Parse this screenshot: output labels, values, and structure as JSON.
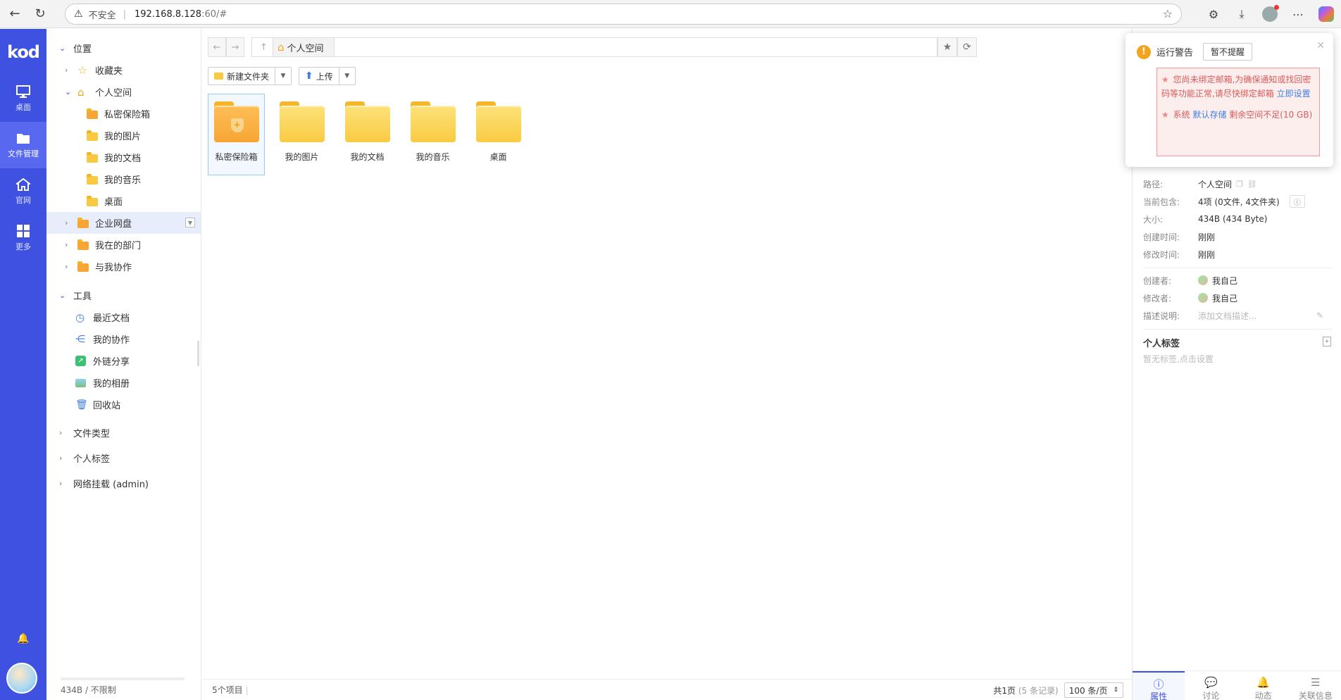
{
  "browser": {
    "security_label": "不安全",
    "url_host": "192.168.8.128",
    "url_rest": ":60/#"
  },
  "rail": {
    "logo": "kod",
    "items": [
      {
        "label": "桌面",
        "icon": "monitor-icon"
      },
      {
        "label": "文件管理",
        "icon": "folder-icon"
      },
      {
        "label": "官网",
        "icon": "home-icon"
      },
      {
        "label": "更多",
        "icon": "grid-icon"
      }
    ]
  },
  "tree": {
    "location_title": "位置",
    "favorites": "收藏夹",
    "personal_space": "个人空间",
    "personal_children": [
      "私密保险箱",
      "我的图片",
      "我的文档",
      "我的音乐",
      "桌面"
    ],
    "enterprise_disk": "企业网盘",
    "my_department": "我在的部门",
    "shared_with_me": "与我协作",
    "tools_title": "工具",
    "tools": [
      "最近文档",
      "我的协作",
      "外链分享",
      "我的相册",
      "回收站"
    ],
    "file_types": "文件类型",
    "personal_tags": "个人标签",
    "network_mount": "网络挂载 (admin)",
    "quota": "434B / 不限制"
  },
  "path": {
    "current": "个人空间"
  },
  "toolbar": {
    "new_folder": "新建文件夹",
    "upload": "上传"
  },
  "files": [
    {
      "name": "私密保险箱",
      "type": "vault"
    },
    {
      "name": "我的图片",
      "type": "folder"
    },
    {
      "name": "我的文档",
      "type": "folder"
    },
    {
      "name": "我的音乐",
      "type": "folder"
    },
    {
      "name": "桌面",
      "type": "folder"
    }
  ],
  "status": {
    "count": "5个项目",
    "page": "共1页",
    "records": "(5 条记录)",
    "page_size": "100 条/页"
  },
  "props": {
    "path_key": "路径:",
    "path_val": "个人空间",
    "contains_key": "当前包含:",
    "contains_val": "4项 (0文件, 4文件夹)",
    "size_key": "大小:",
    "size_val": "434B (434 Byte)",
    "created_key": "创建时间:",
    "created_val": "刚刚",
    "modified_key": "修改时间:",
    "modified_val": "刚刚",
    "creator_key": "创建者:",
    "creator_val": "我自己",
    "modifier_key": "修改者:",
    "modifier_val": "我自己",
    "desc_key": "描述说明:",
    "desc_placeholder": "添加文档描述...",
    "tags_title": "个人标签",
    "tags_empty": "暂无标签,点击设置",
    "tabs": [
      "属性",
      "讨论",
      "动态",
      "关联信息"
    ]
  },
  "popup": {
    "title": "运行警告",
    "dismiss": "暂不提醒",
    "msg1_text": "您尚未绑定邮箱,为确保通知或找回密码等功能正常,请尽快绑定邮箱",
    "msg1_link": "立即设置",
    "msg2_prefix": "系统",
    "msg2_link": "默认存储",
    "msg2_text": "剩余空间不足(10 GB)"
  }
}
